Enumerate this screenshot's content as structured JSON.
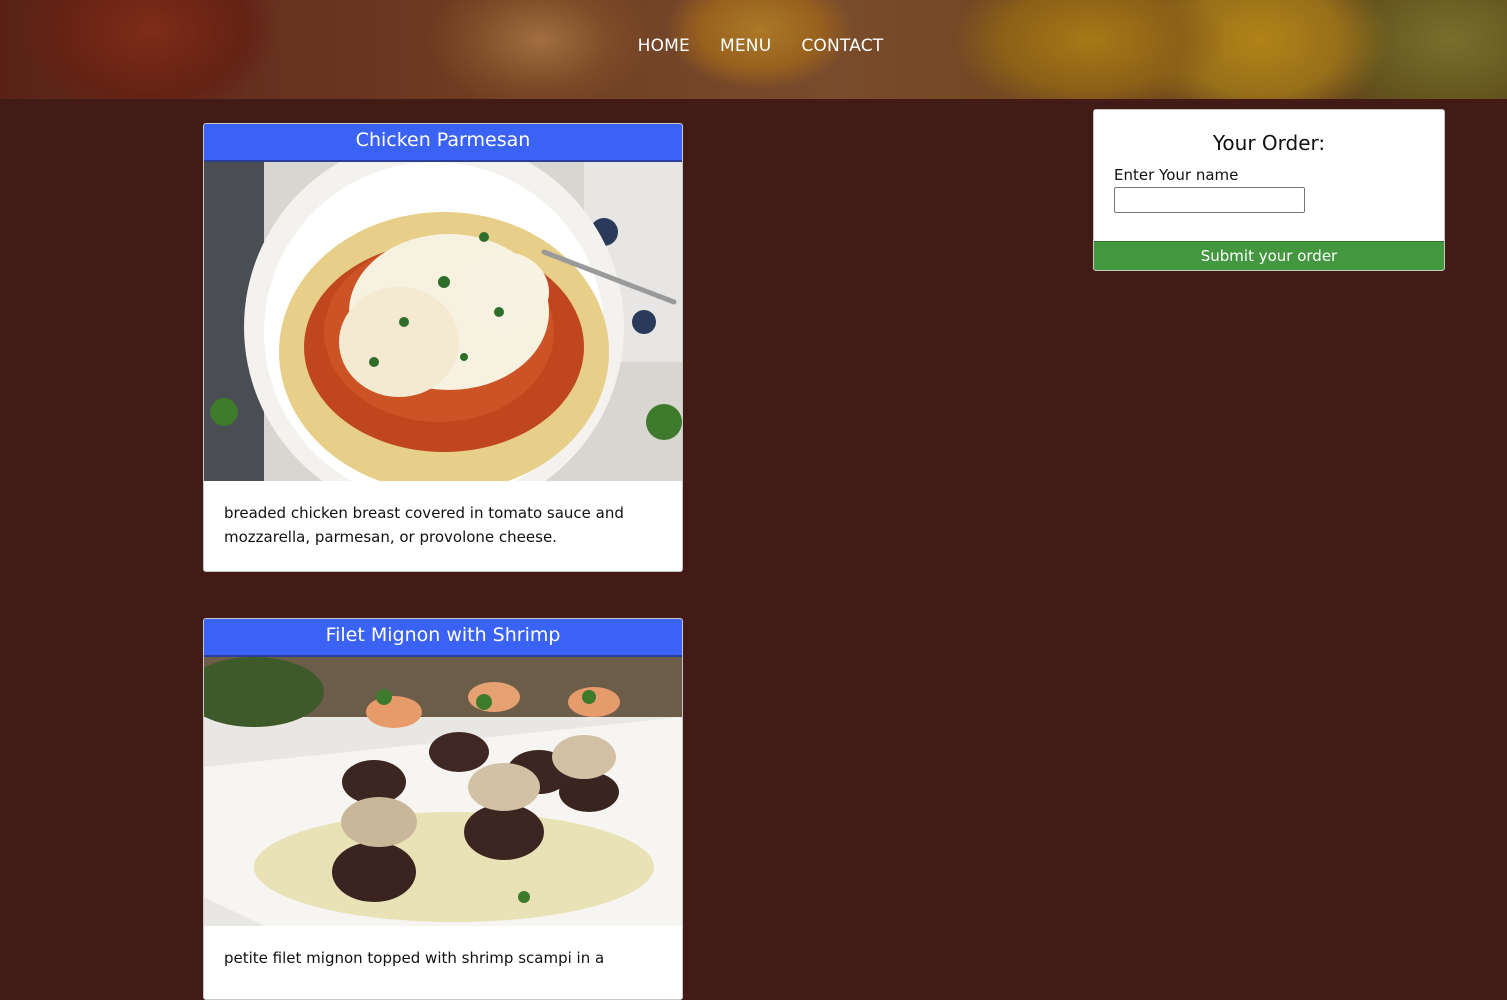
{
  "nav": {
    "items": [
      {
        "label": "HOME"
      },
      {
        "label": "MENU"
      },
      {
        "label": "CONTACT"
      }
    ]
  },
  "menu": {
    "items": [
      {
        "title": "Chicken Parmesan",
        "description": "breaded chicken breast covered in tomato sauce and mozzarella, parmesan, or provolone cheese."
      },
      {
        "title": "Filet Mignon with Shrimp",
        "description": "petite filet mignon topped with shrimp scampi in a"
      }
    ]
  },
  "order": {
    "title": "Your Order:",
    "name_label": "Enter Your name",
    "name_value": "",
    "submit_label": "Submit your order"
  },
  "colors": {
    "page_background": "#421a16",
    "card_title_background": "#3a62f5",
    "submit_background": "#43983f"
  }
}
